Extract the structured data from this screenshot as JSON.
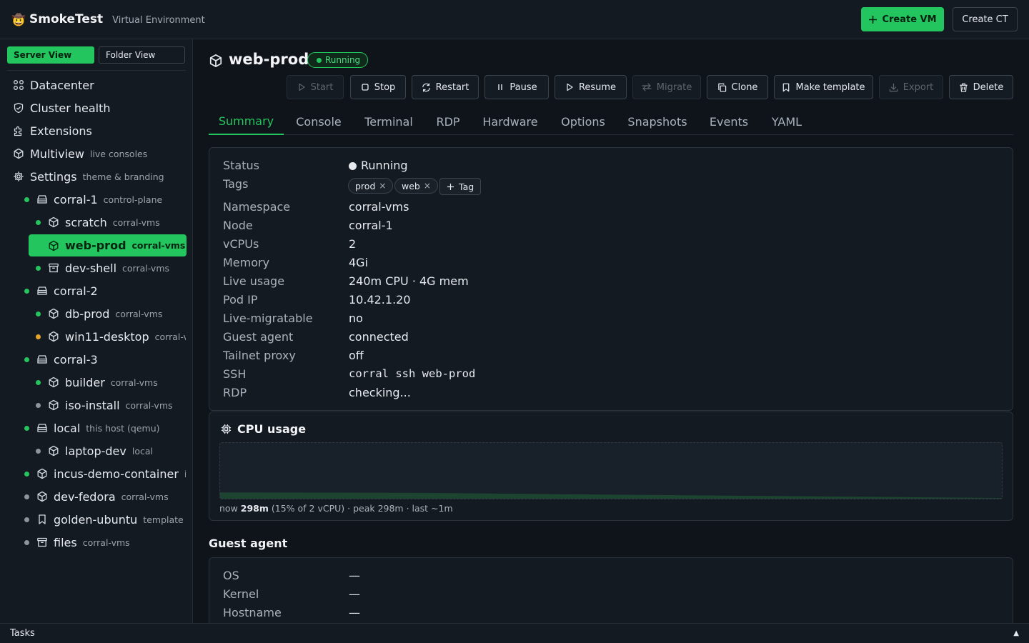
{
  "app": {
    "logo": "🤠",
    "name": "SmokeTest",
    "subtitle": "Virtual Environment"
  },
  "header": {
    "create_vm": "Create VM",
    "create_ct": "Create CT"
  },
  "sidebar": {
    "view_server": "Server View",
    "view_folder": "Folder View",
    "nav": [
      {
        "label": "Datacenter",
        "sub": "",
        "icon": "grid-icon"
      },
      {
        "label": "Cluster health",
        "sub": "",
        "icon": "shield-icon"
      },
      {
        "label": "Extensions",
        "sub": "",
        "icon": "puzzle-icon"
      },
      {
        "label": "Multiview",
        "sub": "live consoles",
        "icon": "cube-icon"
      },
      {
        "label": "Settings",
        "sub": "theme & branding",
        "icon": "gear-icon"
      }
    ],
    "tree": [
      {
        "label": "corral-1",
        "sub": "control-plane",
        "status": "green",
        "icon": "server-icon"
      },
      {
        "label": "scratch",
        "sub": "corral-vms",
        "status": "green",
        "icon": "cube-icon"
      },
      {
        "label": "web-prod",
        "sub": "corral-vms",
        "status": "green",
        "icon": "cube-icon",
        "selected": true
      },
      {
        "label": "dev-shell",
        "sub": "corral-vms",
        "status": "green",
        "icon": "container-icon"
      },
      {
        "label": "corral-2",
        "sub": "",
        "status": "green",
        "icon": "server-icon"
      },
      {
        "label": "db-prod",
        "sub": "corral-vms",
        "status": "green",
        "icon": "cube-icon"
      },
      {
        "label": "win11-desktop",
        "sub": "corral-vms",
        "status": "amber",
        "icon": "cube-icon"
      },
      {
        "label": "corral-3",
        "sub": "",
        "status": "green",
        "icon": "server-icon"
      },
      {
        "label": "builder",
        "sub": "corral-vms",
        "status": "green",
        "icon": "cube-icon"
      },
      {
        "label": "iso-install",
        "sub": "corral-vms",
        "status": "gray",
        "icon": "cube-icon"
      },
      {
        "label": "local",
        "sub": "this host (qemu)",
        "status": "green",
        "icon": "server-icon"
      },
      {
        "label": "laptop-dev",
        "sub": "local",
        "status": "gray",
        "icon": "cube-icon"
      },
      {
        "label": "incus-demo-container",
        "sub": "incus",
        "status": "green",
        "icon": "cube-icon"
      },
      {
        "label": "dev-fedora",
        "sub": "corral-vms",
        "status": "gray",
        "icon": "cube-icon"
      },
      {
        "label": "golden-ubuntu",
        "sub": "template",
        "status": "gray",
        "icon": "bookmark-icon"
      },
      {
        "label": "files",
        "sub": "corral-vms",
        "status": "gray",
        "icon": "container-icon"
      }
    ]
  },
  "vm": {
    "name": "web-prod",
    "status": "Running"
  },
  "actions": {
    "start": "Start",
    "stop": "Stop",
    "restart": "Restart",
    "pause": "Pause",
    "resume": "Resume",
    "migrate": "Migrate",
    "clone": "Clone",
    "make_template": "Make template",
    "export": "Export",
    "delete": "Delete"
  },
  "tabs": [
    "Summary",
    "Console",
    "Terminal",
    "RDP",
    "Hardware",
    "Options",
    "Snapshots",
    "Events",
    "YAML"
  ],
  "summary": {
    "status_key": "Status",
    "status_val": "Running",
    "tags_key": "Tags",
    "tags": [
      "prod",
      "web"
    ],
    "tag_add": "Tag",
    "tag_remove_glyph": "×",
    "rows": [
      {
        "k": "Namespace",
        "v": "corral-vms"
      },
      {
        "k": "Node",
        "v": "corral-1"
      },
      {
        "k": "vCPUs",
        "v": "2"
      },
      {
        "k": "Memory",
        "v": "4Gi"
      },
      {
        "k": "Live usage",
        "v": "240m CPU · 4G mem"
      },
      {
        "k": "Pod IP",
        "v": "10.42.1.20"
      },
      {
        "k": "Live-migratable",
        "v": "no"
      },
      {
        "k": "Guest agent",
        "v": "connected"
      },
      {
        "k": "Tailnet proxy",
        "v": "off"
      },
      {
        "k": "SSH",
        "v": "corral ssh web-prod",
        "mono": true
      },
      {
        "k": "RDP",
        "v": "checking..."
      }
    ]
  },
  "cpu": {
    "title": "CPU usage",
    "caption_now_label": "now",
    "caption_now_value": "298m",
    "caption_rest": "(15% of 2 vCPU) · peak 298m · last ~1m",
    "fill_fraction": 0.15
  },
  "guest_agent": {
    "title": "Guest agent",
    "rows": [
      {
        "k": "OS",
        "v": "—"
      },
      {
        "k": "Kernel",
        "v": "—"
      },
      {
        "k": "Hostname",
        "v": "—"
      }
    ]
  },
  "taskbar": {
    "label": "Tasks",
    "toggle": "▲"
  }
}
